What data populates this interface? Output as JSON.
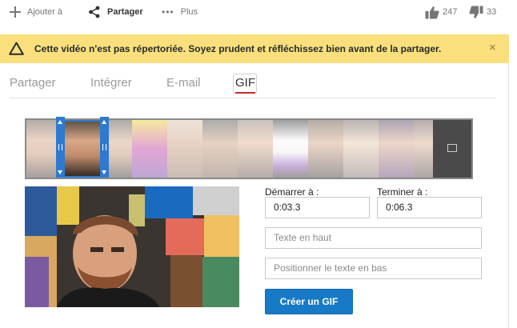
{
  "actions": {
    "add_label": "Ajouter à",
    "share_label": "Partager",
    "more_label": "Plus",
    "likes": "247",
    "dislikes": "33"
  },
  "warning": {
    "message": "Cette vidéo n'est pas répertoriée. Soyez prudent et réfléchissez bien avant de la partager.",
    "close_glyph": "×"
  },
  "tabs": [
    {
      "label": "Partager"
    },
    {
      "label": "Intégrer"
    },
    {
      "label": "E-mail"
    },
    {
      "label": "GIF",
      "active": true
    }
  ],
  "form": {
    "start_label": "Démarrer à :",
    "start_value": "0:03.3",
    "end_label": "Terminer à :",
    "end_value": "0:06.3",
    "top_text_placeholder": "Texte en haut",
    "bottom_text_placeholder": "Positionner le texte en bas",
    "create_button": "Créer un GIF"
  },
  "colors": {
    "warning_bg": "#f9e07c",
    "accent_blue": "#167ac6",
    "tab_underline": "#c8282a",
    "handle_blue": "#2d7ad0"
  },
  "icons": [
    "plus-icon",
    "share-icon",
    "more-dots-icon",
    "thumbs-up-icon",
    "thumbs-down-icon",
    "warning-triangle-icon",
    "close-icon",
    "gif-end-icon"
  ]
}
